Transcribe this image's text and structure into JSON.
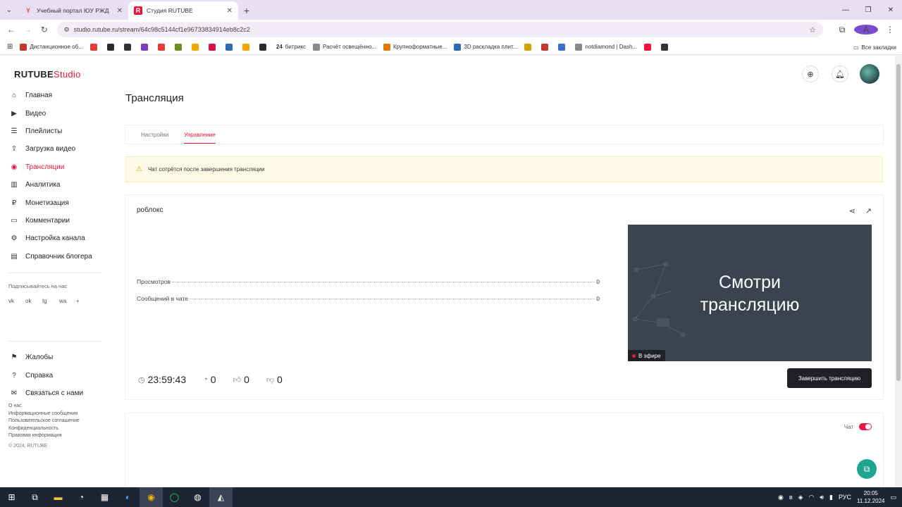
{
  "browser": {
    "tabs": [
      {
        "title": "Учебный портал ЮУ РЖД",
        "favicon": "Y",
        "color": "#e8453c",
        "active": false
      },
      {
        "title": "Студия RUTUBE",
        "favicon": "R",
        "color": "#ed143d",
        "active": true
      }
    ],
    "new_tab": "+",
    "url": "studio.rutube.ru/stream/64c98c5144cf1e96733834914eb8c2c2",
    "profile_initial": "A",
    "bookmarks": [
      {
        "label": "Дистанционное об...",
        "color": "#c0392b"
      },
      {
        "label": "",
        "color": "#e03a3a"
      },
      {
        "label": "",
        "color": "#2b2b2b"
      },
      {
        "label": "",
        "color": "#333"
      },
      {
        "label": "",
        "color": "#7d3cbf"
      },
      {
        "label": "",
        "color": "#e03a3a"
      },
      {
        "label": "",
        "color": "#6b8e23"
      },
      {
        "label": "",
        "color": "#f0a500"
      },
      {
        "label": "",
        "color": "#d14"
      },
      {
        "label": "",
        "color": "#2b6cb0"
      },
      {
        "label": "",
        "color": "#f0a500"
      },
      {
        "label": "",
        "color": "#2b2b2b"
      },
      {
        "label": "битрикс",
        "color": "#1f6fbf"
      },
      {
        "label": "Расчёт освещённо...",
        "color": "#888"
      },
      {
        "label": "Крупноформатные...",
        "color": "#e07b00"
      },
      {
        "label": "3D раскладка плит...",
        "color": "#2b6cb0"
      },
      {
        "label": "",
        "color": "#d4a000"
      },
      {
        "label": "",
        "color": "#c0392b"
      },
      {
        "label": "",
        "color": "#3b6fd4"
      },
      {
        "label": "notdiamond | Dash...",
        "color": "#888"
      },
      {
        "label": "",
        "color": "#ed143d"
      },
      {
        "label": "",
        "color": "#333"
      }
    ],
    "bookmark_24": "24",
    "all_bookmarks": "Все закладки"
  },
  "app": {
    "logo_main": "RUTUBE",
    "logo_sub": "Studio",
    "nav": [
      {
        "label": "Главная",
        "icon": "home-icon",
        "glyph": "⌂",
        "active": false
      },
      {
        "label": "Видео",
        "icon": "video-icon",
        "glyph": "▶",
        "active": false
      },
      {
        "label": "Плейлисты",
        "icon": "playlist-icon",
        "glyph": "☰",
        "active": false
      },
      {
        "label": "Загрузка видео",
        "icon": "upload-icon",
        "glyph": "⇪",
        "active": false
      },
      {
        "label": "Трансляции",
        "icon": "broadcast-icon",
        "glyph": "◉",
        "active": true
      },
      {
        "label": "Аналитика",
        "icon": "analytics-icon",
        "glyph": "▥",
        "active": false
      },
      {
        "label": "Монетизация",
        "icon": "monetization-icon",
        "glyph": "₽",
        "active": false
      },
      {
        "label": "Комментарии",
        "icon": "comments-icon",
        "glyph": "▭",
        "active": false
      },
      {
        "label": "Настройка канала",
        "icon": "settings-icon",
        "glyph": "⚙",
        "active": false
      },
      {
        "label": "Справочник блогера",
        "icon": "book-icon",
        "glyph": "▤",
        "active": false
      }
    ],
    "follow_label": "Подписывайтесь на нас",
    "social": [
      "vk",
      "ok",
      "tg",
      "wa",
      "+"
    ],
    "bottom_nav": [
      {
        "label": "Жалобы",
        "icon": "flag-icon",
        "glyph": "⚑"
      },
      {
        "label": "Справка",
        "icon": "help-icon",
        "glyph": "?"
      },
      {
        "label": "Связаться с нами",
        "icon": "mail-icon",
        "glyph": "✉"
      }
    ],
    "footer": [
      "О нас",
      "Информационные сообщения",
      "Пользовательское соглашение",
      "Конфиденциальность",
      "Правовая информация"
    ],
    "copyright": "© 2024, RUTUBE",
    "page_title": "Трансляция",
    "tabs": [
      "Настройки",
      "Управление"
    ],
    "active_tab": "Управление",
    "warning": "Чат сотрётся после завершения трансляции",
    "stream": {
      "name": "роблокс",
      "views_label": "Просмотров",
      "views_value": "0",
      "messages_label": "Сообщений в чате",
      "messages_value": "0",
      "preview_line1": "Смотри",
      "preview_line2": "трансляцию",
      "live_label": "В эфире",
      "duration": "23:59:43",
      "viewers": "0",
      "likes": "0",
      "dislikes": "0",
      "end_button": "Завершить трансляцию"
    },
    "chat_label": "Чат",
    "chat_enabled": true
  },
  "taskbar": {
    "lang": "РУС",
    "time": "20:05",
    "date": "11.12.2024"
  },
  "colors": {
    "accent": "#ed143d",
    "primary_dark": "#1f2126",
    "fab": "#1fa58f"
  }
}
